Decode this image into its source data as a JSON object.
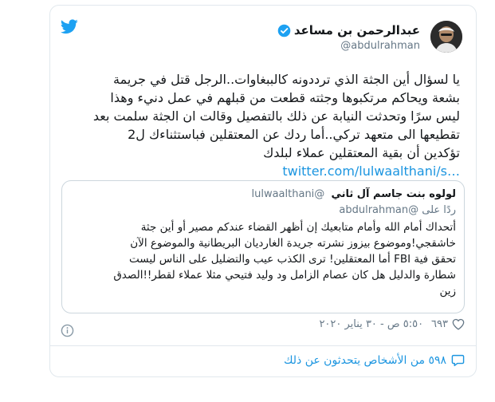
{
  "author": {
    "name": "عبدالرحمن بن مساعد",
    "handle": "@abdulrahman"
  },
  "tweet": {
    "lines": [
      "يا لسؤال أين الجثة الذي ترددونه كالببغاوات..الرجل قتل في جريمة",
      "بشعة ويحاكم مرتكبوها وجثته قطعت من قبلهم في عمل دنيء وهذا",
      "ليس سرًا وتحدثت النيابة عن ذلك بالتفصيل وقالت ان الجثة سلمت بعد",
      "تقطيعها الى متعهد تركي..أما ردك عن المعتقلين فباستثناءك ل2",
      "تؤكدين أن بقية المعتقلين عملاء لبلدك"
    ],
    "link": "twitter.com/lulwaalthani/s…"
  },
  "quote": {
    "name": "لولوه بنت جاسم آل ثاني",
    "handle": "@lulwaalthani",
    "reply_prefix": "ردًا على",
    "reply_handle": "@abdulrahman",
    "lines": [
      "أتحداك أمام الله وأمام متابعيك إن أظهر القضاء عندكم مصير أو أين جثة",
      "خاشقجي!وموضوع بيزوز نشرته جريدة الغارديان البريطانية والموضوع الآن",
      "تحقق فية FBI أما المعتقلين! ترى الكذب عيب والتضليل على الناس ليست",
      "شطارة والدليل هل كان عصام الزامل ود وليد فتيحي مثلا عملاء لقطر!!الصدق",
      "زين"
    ]
  },
  "meta": {
    "likes": "٦٩٣",
    "timestamp": "٥:٥٠ ص - ٣٠ يناير ٢٠٢٠"
  },
  "footer": {
    "people_talking": "٥٩٨ من الأشخاص يتحدثون عن ذلك"
  },
  "colors": {
    "brand": "#1da1f2",
    "link": "#1b95e0",
    "muted": "#657786",
    "border": "#e1e8ed"
  },
  "icons": [
    "twitter-bird-icon",
    "verified-badge-icon",
    "heart-icon",
    "info-icon",
    "speech-bubble-icon"
  ]
}
